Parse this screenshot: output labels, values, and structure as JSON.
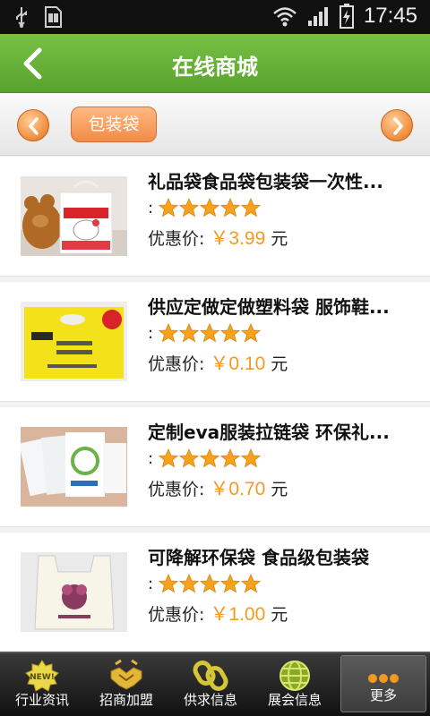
{
  "status_bar": {
    "time": "17:45"
  },
  "header": {
    "title": "在线商城"
  },
  "category": {
    "selected": "包装袋"
  },
  "products": [
    {
      "title": "礼品袋食品袋包装袋一次性...",
      "rating_prefix": ":",
      "stars": 5,
      "price_label": "优惠价:",
      "price": "￥3.99",
      "unit": "元"
    },
    {
      "title": "供应定做定做塑料袋 服饰鞋...",
      "rating_prefix": ":",
      "stars": 5,
      "price_label": "优惠价:",
      "price": "￥0.10",
      "unit": "元"
    },
    {
      "title": "定制eva服装拉链袋 环保礼...",
      "rating_prefix": ":",
      "stars": 5,
      "price_label": "优惠价:",
      "price": "￥0.70",
      "unit": "元"
    },
    {
      "title": "可降解环保袋 食品级包装袋",
      "rating_prefix": ":",
      "stars": 5,
      "price_label": "优惠价:",
      "price": "￥1.00",
      "unit": "元"
    }
  ],
  "bottom_nav": [
    {
      "label": "行业资讯",
      "icon": "new-badge-icon"
    },
    {
      "label": "招商加盟",
      "icon": "handshake-icon"
    },
    {
      "label": "供求信息",
      "icon": "chain-link-icon"
    },
    {
      "label": "展会信息",
      "icon": "globe-icon"
    },
    {
      "label": "更多",
      "icon": "more-dots-icon",
      "active": true
    }
  ],
  "colors": {
    "header_green": "#66b23a",
    "price_orange": "#f39a1f",
    "chip_orange": "#f38a47"
  }
}
